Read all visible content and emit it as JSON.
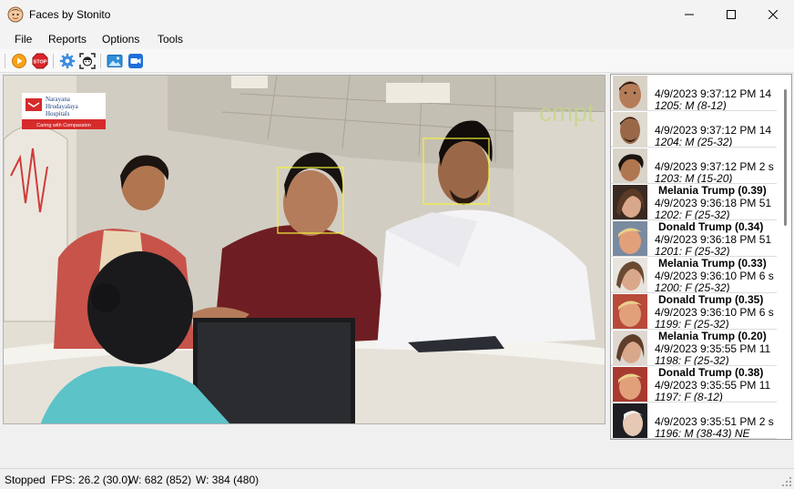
{
  "window": {
    "title": "Faces by Stonito"
  },
  "menu": [
    "File",
    "Reports",
    "Options",
    "Tools"
  ],
  "toolbar": {
    "play_icon": "play-icon",
    "stop_icon": "stop-icon",
    "stop_label": "STOP",
    "settings_icon": "gear-icon",
    "face_detect_icon": "face-detect-icon",
    "image_icon": "image-icon",
    "camera_icon": "video-camera-icon"
  },
  "video": {
    "logo_lines": [
      "Narayana",
      "Hrudayalaya",
      "Hospitals"
    ],
    "logo_tagline": "Caring with Compassion",
    "watermark": "cmpt"
  },
  "faces": [
    {
      "name": "",
      "datetime": "4/9/2023 9:37:12 PM 14",
      "info": "1205: M (8-12)"
    },
    {
      "name": "",
      "datetime": "4/9/2023 9:37:12 PM 14",
      "info": "1204: M (25-32)"
    },
    {
      "name": "",
      "datetime": "4/9/2023 9:37:12 PM 2 s",
      "info": "1203: M (15-20)"
    },
    {
      "name": "Melania Trump (0.39)",
      "datetime": "4/9/2023 9:36:18 PM 51",
      "info": "1202: F (25-32)"
    },
    {
      "name": "Donald Trump (0.34)",
      "datetime": "4/9/2023 9:36:18 PM 51",
      "info": "1201: F (25-32)"
    },
    {
      "name": "Melania Trump (0.33)",
      "datetime": "4/9/2023 9:36:10 PM 6 s",
      "info": "1200: F (25-32)"
    },
    {
      "name": "Donald Trump (0.35)",
      "datetime": "4/9/2023 9:36:10 PM 6 s",
      "info": "1199: F (25-32)"
    },
    {
      "name": "Melania Trump (0.20)",
      "datetime": "4/9/2023 9:35:55 PM 11",
      "info": "1198: F (25-32)"
    },
    {
      "name": "Donald Trump (0.38)",
      "datetime": "4/9/2023 9:35:55 PM 11",
      "info": "1197: F (8-12)"
    },
    {
      "name": "",
      "datetime": "4/9/2023 9:35:51 PM 2 s",
      "info": "1196: M (38-43) NE"
    }
  ],
  "status": {
    "state": "Stopped",
    "fps": "FPS: 26.2 (30.0)",
    "w1": "W: 682 (852)",
    "w2": "W: 384 (480)"
  }
}
